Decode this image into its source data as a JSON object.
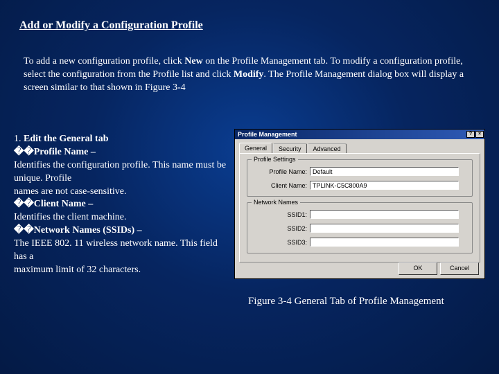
{
  "heading": "Add or Modify a Configuration Profile",
  "intro": {
    "t1": "To add a new configuration profile, click ",
    "b1": "New",
    "t2": " on the Profile Management tab. To modify a configuration profile, select the configuration from the Profile list and click ",
    "b2": "Modify",
    "t3": ". The Profile Management dialog box will display a screen similar to that shown in Figure 3-4"
  },
  "left": {
    "l1a": "1. ",
    "l1b": "Edit the General tab",
    "l2a": "��",
    "l2b": "Profile Name –",
    "l3": " Identifies the configuration profile. This name must be unique. Profile",
    "l4": "names are not case-sensitive.",
    "l5a": "��",
    "l5b": "Client Name –",
    "l6": "Identifies the client machine.",
    "l7a": "��",
    "l7b": "Network Names (SSIDs) –",
    "l8": "The IEEE 802. 11 wireless network name. This field has a",
    "l9": "maximum limit of 32 characters."
  },
  "caption": "Figure 3-4 General Tab of Profile Management",
  "dialog": {
    "title": "Profile Management",
    "help": "?",
    "close": "×",
    "tabs": {
      "general": "General",
      "security": "Security",
      "advanced": "Advanced"
    },
    "group1": "Profile Settings",
    "group2": "Network Names",
    "profile_name_lbl": "Profile Name:",
    "profile_name_val": "Default",
    "client_name_lbl": "Client Name:",
    "client_name_val": "TPLINK-C5C800A9",
    "ssid1_lbl": "SSID1:",
    "ssid2_lbl": "SSID2:",
    "ssid3_lbl": "SSID3:",
    "ok": "OK",
    "cancel": "Cancel"
  }
}
